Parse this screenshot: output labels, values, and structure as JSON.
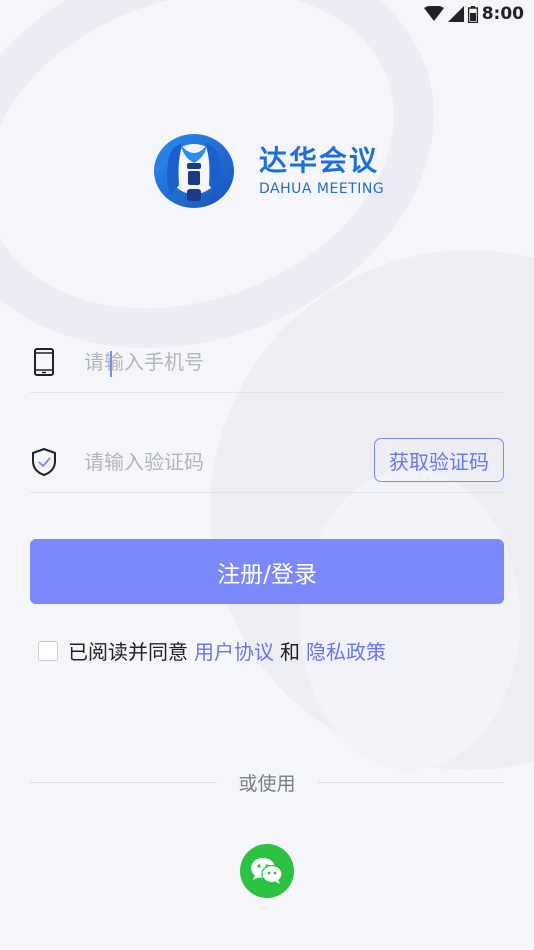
{
  "status_bar": {
    "time": "8:00"
  },
  "logo": {
    "name_cn": "达华会议",
    "name_en": "DAHUA MEETING"
  },
  "phone_field": {
    "placeholder": "请输入手机号",
    "value": ""
  },
  "code_field": {
    "placeholder": "请输入验证码",
    "value": ""
  },
  "get_code_button": {
    "label": "获取验证码"
  },
  "login_button": {
    "label": "注册/登录"
  },
  "agreement": {
    "checked": false,
    "prefix": "已阅读并同意",
    "user_agreement": "用户协议",
    "and": "和",
    "privacy_policy": "隐私政策"
  },
  "alt_login": {
    "divider_text": "或使用",
    "wechat_icon": "wechat-icon"
  },
  "colors": {
    "accent": "#7b89fb",
    "link": "#6976ef",
    "brand": "#1e6fd9",
    "wechat": "#2cc343"
  }
}
